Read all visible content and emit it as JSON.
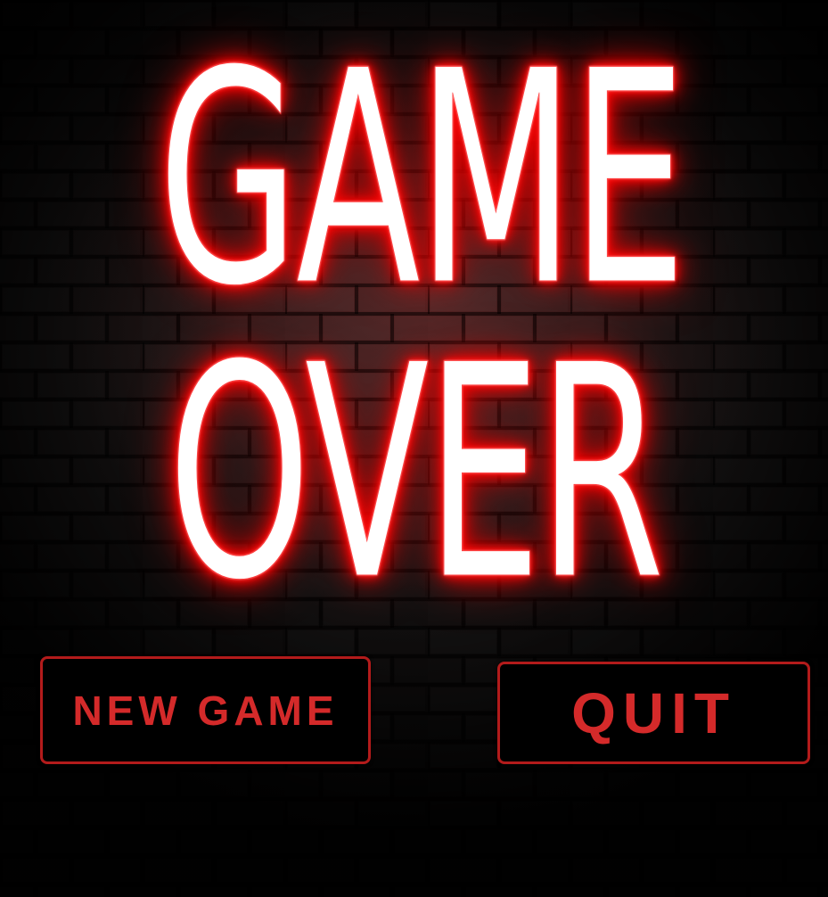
{
  "screen": {
    "title_line_1": "GAME",
    "title_line_2": "OVER"
  },
  "menu": {
    "new_game_label": "NEW GAME",
    "quit_label": "QUIT"
  },
  "colors": {
    "neon_glow": "#ff1010",
    "neon_core": "#ffffff",
    "button_border": "#b31b1b",
    "button_text": "#d42a2a",
    "background": "#050404"
  }
}
